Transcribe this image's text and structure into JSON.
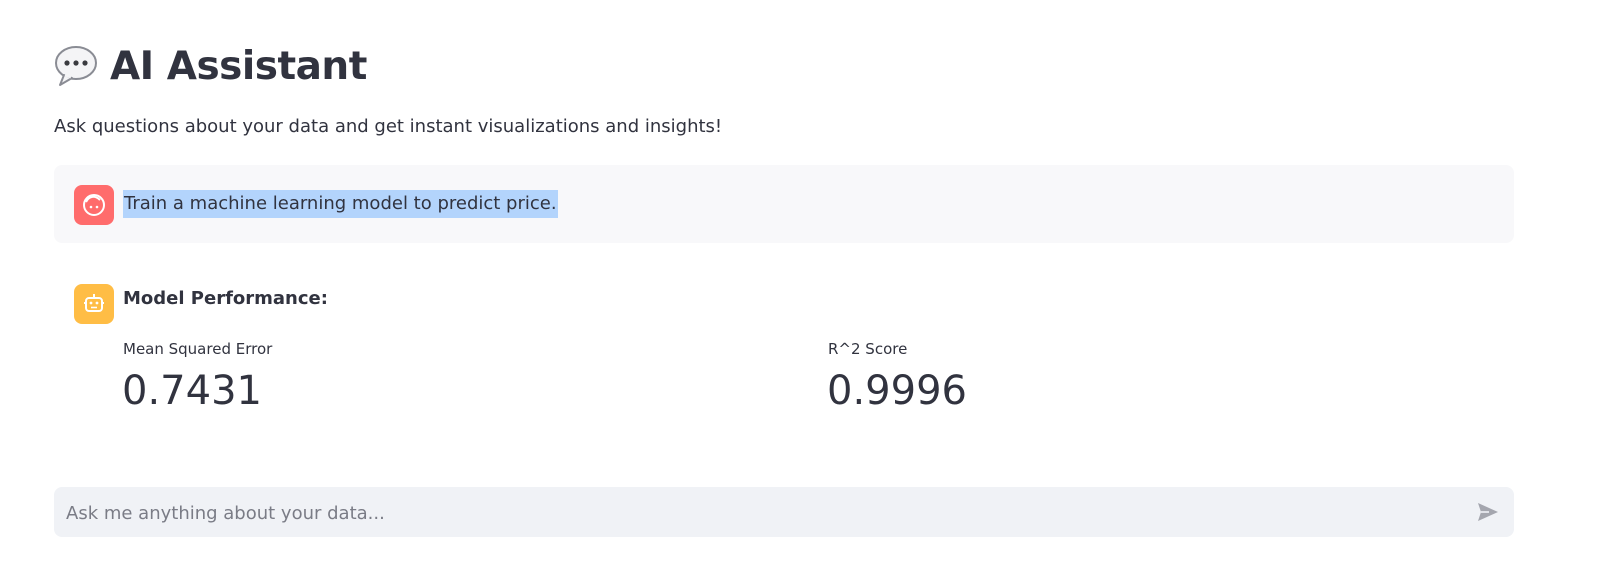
{
  "header": {
    "title": "AI Assistant",
    "title_icon": "speech-bubble-icon",
    "subtitle": "Ask questions about your data and get instant visualizations and insights!"
  },
  "chat": {
    "user_message": {
      "avatar_icon": "user-face-icon",
      "avatar_color": "#ff6c6c",
      "text": "Train a machine learning model to predict price."
    },
    "assistant_message": {
      "avatar_icon": "robot-icon",
      "avatar_color": "#ffbd45",
      "heading": "Model Performance:",
      "metrics": [
        {
          "label": "Mean Squared Error",
          "value": "0.7431"
        },
        {
          "label": "R^2 Score",
          "value": "0.9996"
        }
      ]
    }
  },
  "input": {
    "placeholder": "Ask me anything about your data...",
    "value": "",
    "send_icon": "send-arrow-icon"
  },
  "colors": {
    "text": "#31333f",
    "selection": "#b3d4fc",
    "input_bg": "#f0f2f6"
  }
}
